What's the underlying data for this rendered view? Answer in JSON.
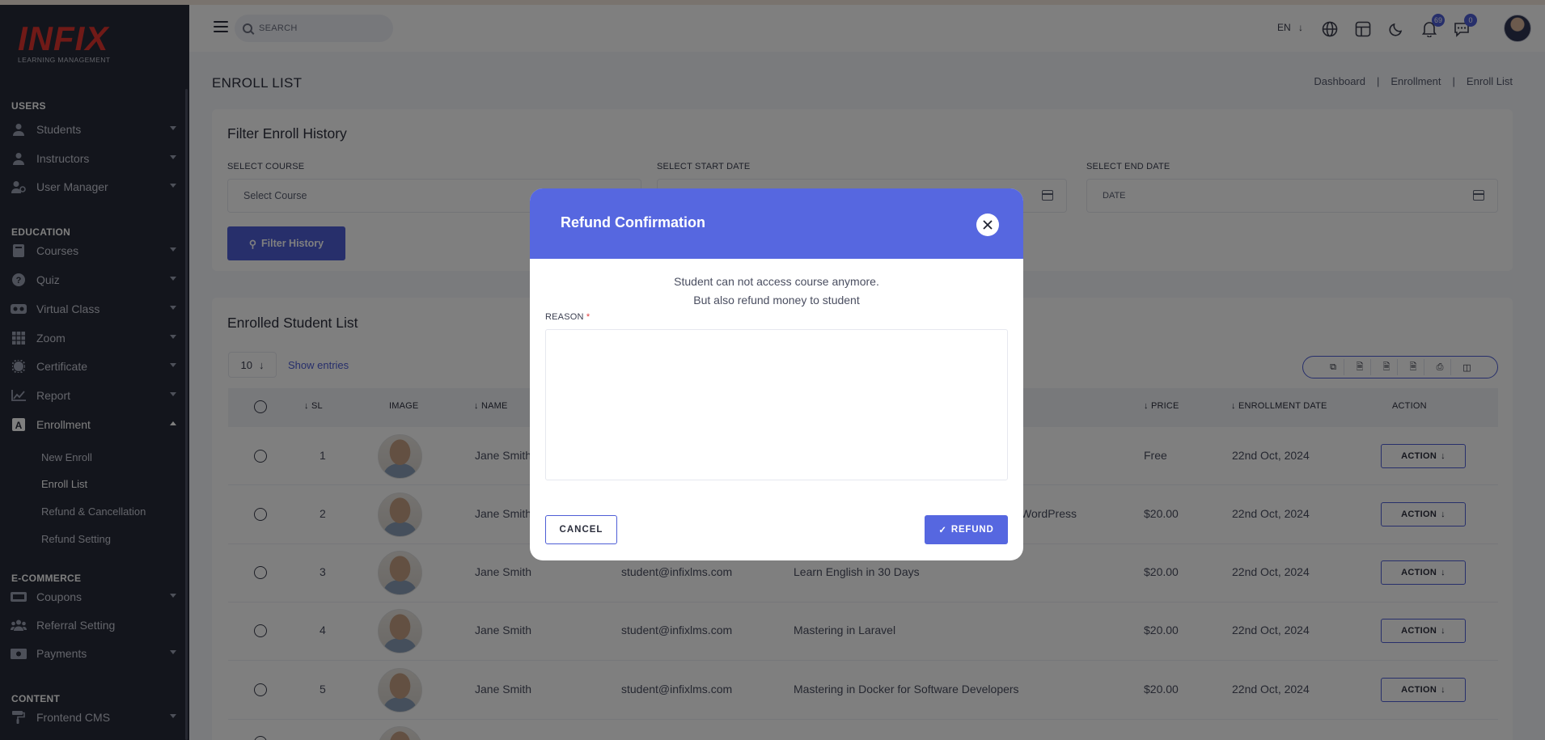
{
  "app": {
    "logo_text": "INFIX",
    "logo_subtitle": "LEARNING MANAGEMENT"
  },
  "sidebar": {
    "sections": [
      {
        "title": "USERS"
      },
      {
        "title": "EDUCATION"
      },
      {
        "title": "E-COMMERCE"
      },
      {
        "title": "CONTENT"
      }
    ],
    "items": [
      {
        "label": "Students",
        "icon": "user-icon"
      },
      {
        "label": "Instructors",
        "icon": "instructor-icon"
      },
      {
        "label": "User Manager",
        "icon": "user-manager-icon"
      },
      {
        "label": "Courses",
        "icon": "book-icon"
      },
      {
        "label": "Quiz",
        "icon": "question-icon"
      },
      {
        "label": "Virtual Class",
        "icon": "vr-icon"
      },
      {
        "label": "Zoom",
        "icon": "grid-icon"
      },
      {
        "label": "Certificate",
        "icon": "certificate-icon"
      },
      {
        "label": "Report",
        "icon": "chart-icon"
      },
      {
        "label": "Enrollment",
        "icon": "enrollment-icon"
      },
      {
        "label": "Coupons",
        "icon": "coupon-icon"
      },
      {
        "label": "Referral Setting",
        "icon": "referral-icon"
      },
      {
        "label": "Payments",
        "icon": "money-icon"
      },
      {
        "label": "Frontend CMS",
        "icon": "paint-roller-icon"
      }
    ],
    "enrollment_sub": [
      "New Enroll",
      "Enroll List",
      "Refund & Cancellation",
      "Refund Setting"
    ]
  },
  "topbar": {
    "search_placeholder": "SEARCH",
    "language": "EN",
    "notification_count": "69",
    "message_count": "0"
  },
  "page": {
    "title": "ENROLL LIST",
    "breadcrumb": [
      "Dashboard",
      "Enrollment",
      "Enroll List"
    ]
  },
  "filter": {
    "title": "Filter Enroll History",
    "course_label": "SELECT COURSE",
    "course_value": "Select Course",
    "start_label": "SELECT START DATE",
    "end_label": "SELECT END DATE",
    "end_placeholder": "DATE",
    "button": "Filter History"
  },
  "list": {
    "title": "Enrolled Student List",
    "entries": "10",
    "entries_label": "Show entries",
    "columns": [
      "SL",
      "IMAGE",
      "NAME",
      "PRICE",
      "ENROLLMENT DATE",
      "ACTION"
    ],
    "action_label": "ACTION",
    "rows": [
      {
        "sl": "1",
        "name": "Jane Smith",
        "email": "",
        "course": "",
        "price": "Free",
        "date": "22nd Oct, 2024"
      },
      {
        "sl": "2",
        "name": "Jane Smith",
        "email": "",
        "course": "WordPress",
        "price": "$20.00",
        "date": "22nd Oct, 2024"
      },
      {
        "sl": "3",
        "name": "Jane Smith",
        "email": "student@infixlms.com",
        "course": "Learn English in 30 Days",
        "price": "$20.00",
        "date": "22nd Oct, 2024"
      },
      {
        "sl": "4",
        "name": "Jane Smith",
        "email": "student@infixlms.com",
        "course": "Mastering in Laravel",
        "price": "$20.00",
        "date": "22nd Oct, 2024"
      },
      {
        "sl": "5",
        "name": "Jane Smith",
        "email": "student@infixlms.com",
        "course": "Mastering in Docker for Software Developers",
        "price": "$20.00",
        "date": "22nd Oct, 2024"
      }
    ]
  },
  "modal": {
    "title": "Refund Confirmation",
    "message_line1": "Student can not access course anymore.",
    "message_line2": "But also refund money to student",
    "reason_label": "REASON",
    "required_mark": "*",
    "cancel": "CANCEL",
    "refund": "REFUND"
  },
  "colors": {
    "accent": "#4e5ed6",
    "modal_header": "#5667e0",
    "sidebar_bg": "#262a38",
    "logo_red": "#e0342f",
    "required_red": "#e03b3b"
  }
}
